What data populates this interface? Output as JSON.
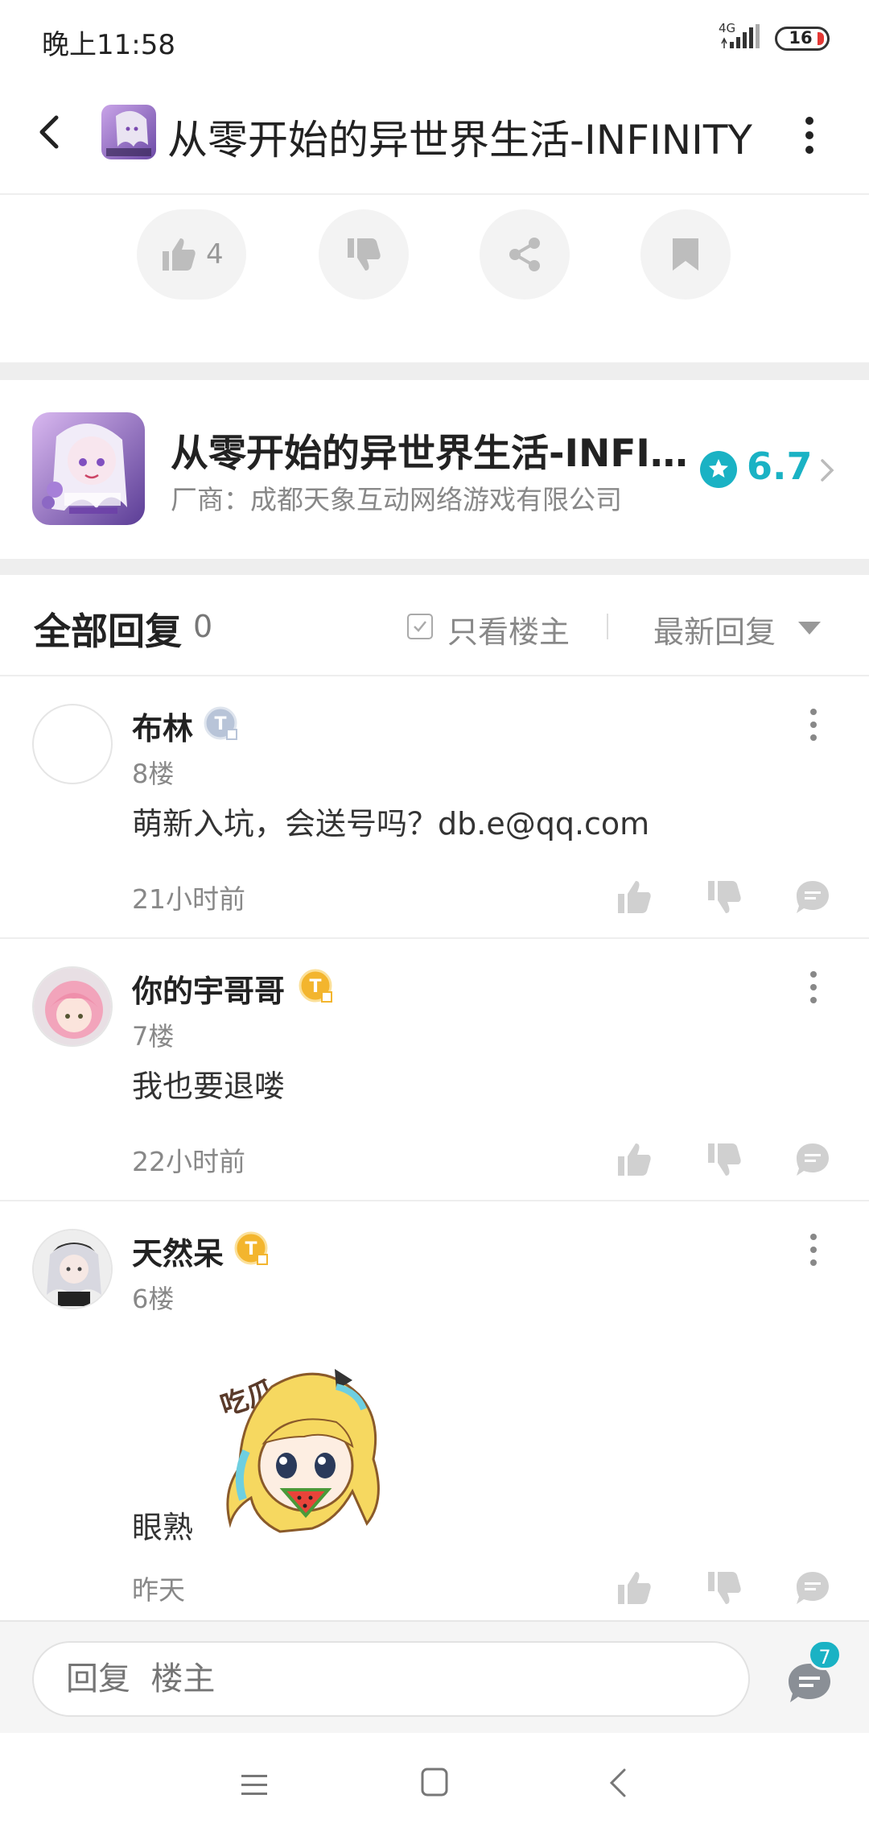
{
  "status_bar": {
    "time": "晚上11:58",
    "network": "4G",
    "battery": "16"
  },
  "header": {
    "title": "从零开始的异世界生活-INFINITY"
  },
  "actions": {
    "like_count": "4"
  },
  "game": {
    "title": "从零开始的异世界生活-INFINITY",
    "vendor": "厂商：成都天象互动网络游戏有限公司",
    "rating": "6.7"
  },
  "replies_header": {
    "title": "全部回复",
    "count": "0",
    "only_op_label": "只看楼主",
    "sort_label": "最新回复"
  },
  "comments": [
    {
      "name": "布林",
      "badge_color": "#b8c4d8",
      "floor": "8楼",
      "text": "萌新入坑，会送号吗？db.e@qq.com",
      "time": "21小时前"
    },
    {
      "name": "你的宇哥哥",
      "badge_color": "#f3b52e",
      "floor": "7楼",
      "text": "我也要退喽",
      "time": "22小时前"
    },
    {
      "name": "天然呆",
      "badge_color": "#f3b52e",
      "floor": "6楼",
      "text": "眼熟",
      "time": "昨天",
      "sticker_text": "吃瓜···"
    }
  ],
  "reply_bar": {
    "placeholder": "回复  楼主",
    "badge_count": "7"
  },
  "colors": {
    "accent": "#1ab2c4"
  }
}
